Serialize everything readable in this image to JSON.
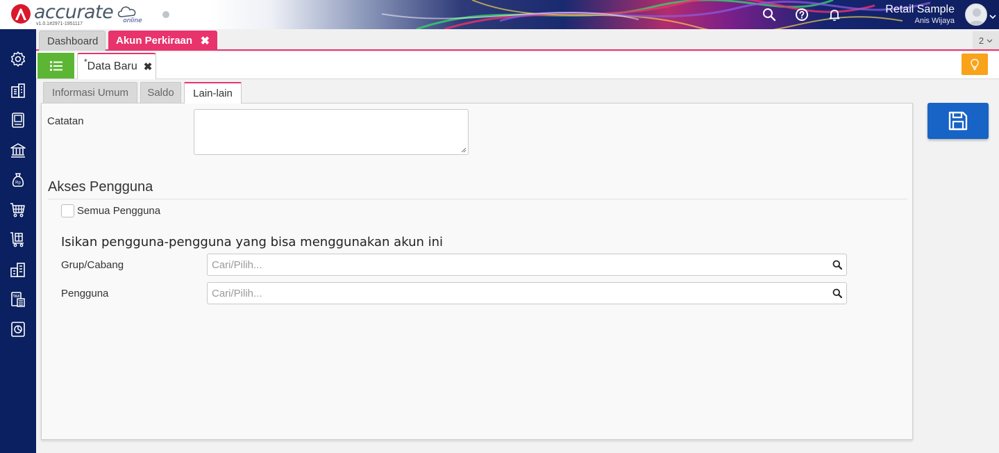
{
  "app": {
    "brand": "accurate",
    "brand_suffix": "online",
    "version": "v1.0.1#2971-1951117"
  },
  "header": {
    "company_name": "Retail Sample",
    "user_name": "Anis Wijaya",
    "icons": [
      "search-icon",
      "help-icon",
      "bell-icon"
    ]
  },
  "sidebar": {
    "items": [
      "gear-icon",
      "company-icon",
      "ledger-icon",
      "bank-icon",
      "money-bag-icon",
      "cart-icon",
      "purchase-icon",
      "inventory-icon",
      "tax-icon",
      "report-icon"
    ]
  },
  "tabs": {
    "dashboard": "Dashboard",
    "akun": "Akun Perkiraan",
    "akun_close": "✖",
    "count": "2"
  },
  "doc": {
    "star": "*",
    "title": "Data Baru",
    "close": "✖"
  },
  "form_tabs": {
    "umum": "Informasi Umum",
    "saldo": "Saldo",
    "lain": "Lain-lain"
  },
  "form": {
    "catatan_label": "Catatan",
    "catatan_value": "",
    "section_title": "Akses Pengguna",
    "semua_label": "Semua Pengguna",
    "semua_checked": false,
    "sub_heading": "Isikan pengguna-pengguna yang bisa menggunakan akun ini",
    "grup_label": "Grup/Cabang",
    "grup_placeholder": "Cari/Pilih...",
    "pengguna_label": "Pengguna",
    "pengguna_placeholder": "Cari/Pilih..."
  },
  "colors": {
    "sidebar": "#0a2060",
    "accent": "#e8336d",
    "list_button": "#5cb634",
    "tip_button": "#f9a31b",
    "save_button": "#1763c6"
  }
}
